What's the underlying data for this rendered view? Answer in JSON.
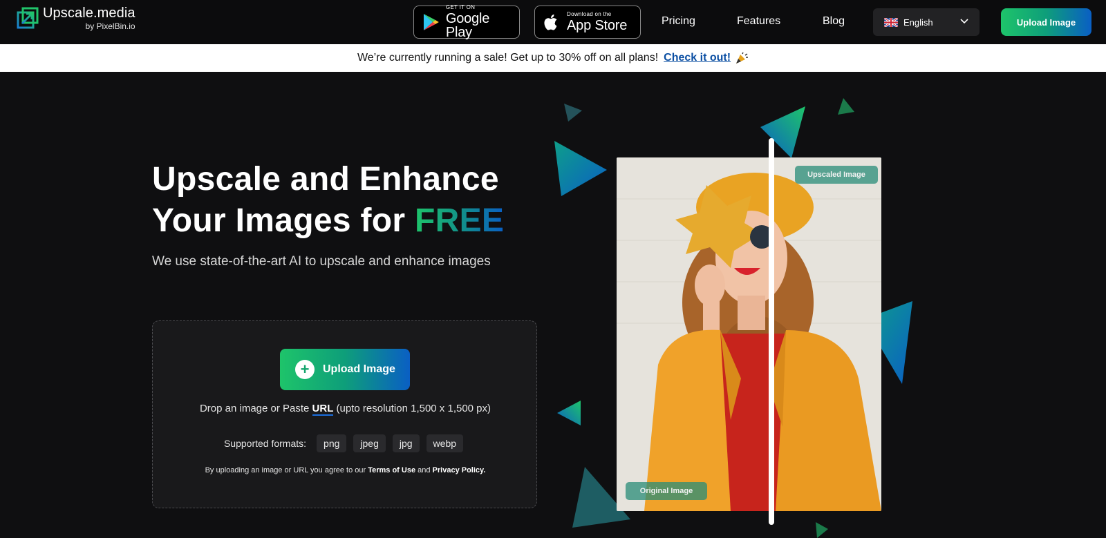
{
  "nav": {
    "logo_title": "Upscale.media",
    "logo_sub": "by PixelBin.io",
    "google_play": {
      "small": "GET IT ON",
      "big": "Google Play"
    },
    "app_store": {
      "small": "Download on the",
      "big": "App Store"
    },
    "links": [
      "Pricing",
      "Features",
      "Blog"
    ],
    "language": "English",
    "upload_label": "Upload Image"
  },
  "banner": {
    "text": "We’re currently running a sale! Get up to 30% off on all plans!",
    "link": "Check it out!"
  },
  "hero": {
    "title_line1": "Upscale and Enhance",
    "title_line2": "Your Images for ",
    "title_highlight": "FREE",
    "subtitle": "We use state-of-the-art AI to upscale and enhance images",
    "upload_label": "Upload Image",
    "drop_prefix": "Drop an image or Paste ",
    "drop_url": "URL",
    "drop_suffix": " (upto resolution 1,500 x 1,500 px)",
    "formats_label": "Supported formats:",
    "formats": [
      "png",
      "jpeg",
      "jpg",
      "webp"
    ],
    "terms_prefix": "By uploading an image or URL you agree to our ",
    "terms_link": "Terms of Use",
    "terms_and": " and ",
    "privacy_link": "Privacy Policy."
  },
  "visual": {
    "upscaled_label": "Upscaled Image",
    "original_label": "Original Image"
  },
  "colors": {
    "accent_green": "#1ec46a",
    "accent_blue": "#0a5fc4",
    "link_blue": "#0b4fa3"
  }
}
